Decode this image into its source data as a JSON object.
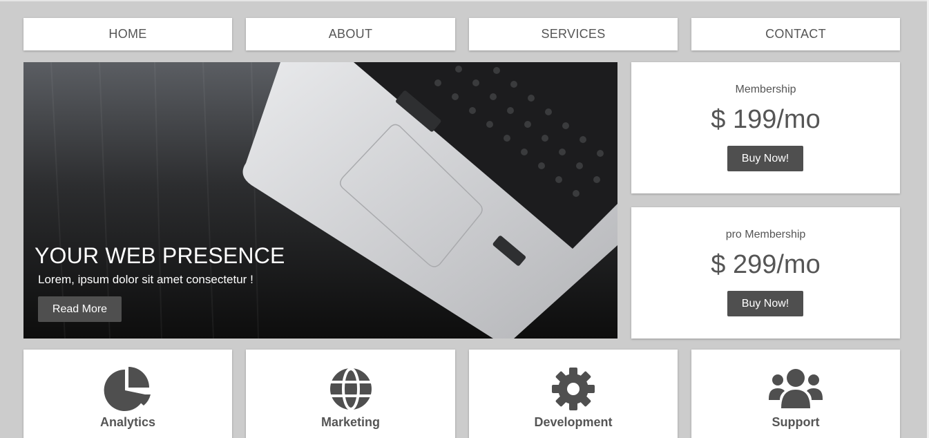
{
  "nav": {
    "items": [
      "HOME",
      "ABOUT",
      "SERVICES",
      "CONTACT"
    ]
  },
  "hero": {
    "title": "YOUR WEB PRESENCE",
    "subtitle": "Lorem, ipsum dolor sit amet consectetur !",
    "button_label": "Read More"
  },
  "pricing": [
    {
      "name": "Membership",
      "price": "$ 199/mo",
      "button_label": "Buy Now!"
    },
    {
      "name": "pro Membership",
      "price": "$ 299/mo",
      "button_label": "Buy Now!"
    }
  ],
  "services": [
    {
      "label": "Analytics",
      "icon": "pie-chart-icon"
    },
    {
      "label": "Marketing",
      "icon": "globe-icon"
    },
    {
      "label": "Development",
      "icon": "gear-icon"
    },
    {
      "label": "Support",
      "icon": "users-icon"
    }
  ],
  "colors": {
    "page_bg": "#cccccc",
    "card_bg": "#ffffff",
    "text": "#555555",
    "button_bg": "#4f4f4f"
  }
}
